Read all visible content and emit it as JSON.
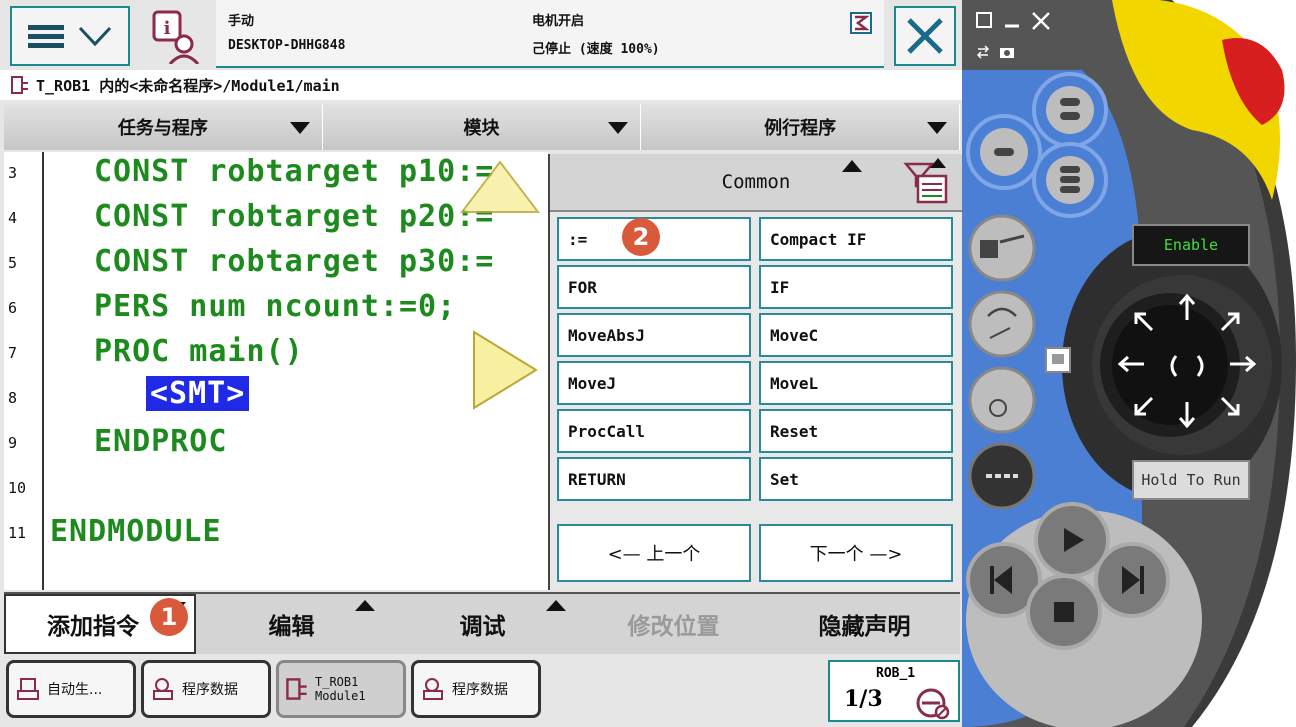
{
  "status": {
    "mode": "手动",
    "system_name": "DESKTOP-DHHG848",
    "motors": "电机开启",
    "state": "己停止 (速度 100%)"
  },
  "breadcrumb": "T_ROB1 内的<未命名程序>/Module1/main",
  "nav_tabs": [
    {
      "label": "任务与程序"
    },
    {
      "label": "模块"
    },
    {
      "label": "例行程序"
    }
  ],
  "editor": {
    "lines": [
      {
        "num": "3",
        "text": "CONST robtarget p10:="
      },
      {
        "num": "4",
        "text": "CONST robtarget p20:="
      },
      {
        "num": "5",
        "text": "CONST robtarget p30:="
      },
      {
        "num": "6",
        "text": "PERS num ncount:=0;"
      },
      {
        "num": "7",
        "text": "PROC main()"
      },
      {
        "num": "8",
        "text": "<SMT>"
      },
      {
        "num": "9",
        "text": "ENDPROC"
      },
      {
        "num": "10",
        "text": ""
      },
      {
        "num": "11",
        "text": "ENDMODULE"
      }
    ]
  },
  "instruction_panel": {
    "title": "Common",
    "items": [
      ":=",
      "Compact IF",
      "FOR",
      "IF",
      "MoveAbsJ",
      "MoveC",
      "MoveJ",
      "MoveL",
      "ProcCall",
      "Reset",
      "RETURN",
      "Set"
    ],
    "prev_label": "<—  上一个",
    "next_label": "下一个  —>"
  },
  "command_bar": {
    "add_instruction": "添加指令",
    "edit": "编辑",
    "debug": "调试",
    "modify_position": "修改位置",
    "hide_declarations": "隐藏声明"
  },
  "taskbar": {
    "items": [
      {
        "label": "自动生..."
      },
      {
        "label": "程序数据"
      },
      {
        "label": "T_ROB1\nModule1"
      },
      {
        "label": "程序数据"
      }
    ],
    "rob_label": "ROB_1",
    "rob_fraction": "1/3"
  },
  "badges": [
    "1",
    "2"
  ],
  "pendant": {
    "enable_label": "Enable",
    "hold_label": "Hold To Run"
  },
  "colors": {
    "accent": "#1a8a8a",
    "code_green": "#1d8a1d",
    "smt_blue": "#1f29e6",
    "badge": "#d95a3a",
    "pendant_blue": "#4a7fd4",
    "estop_red": "#d81f1f",
    "estop_yellow": "#f2d600"
  }
}
